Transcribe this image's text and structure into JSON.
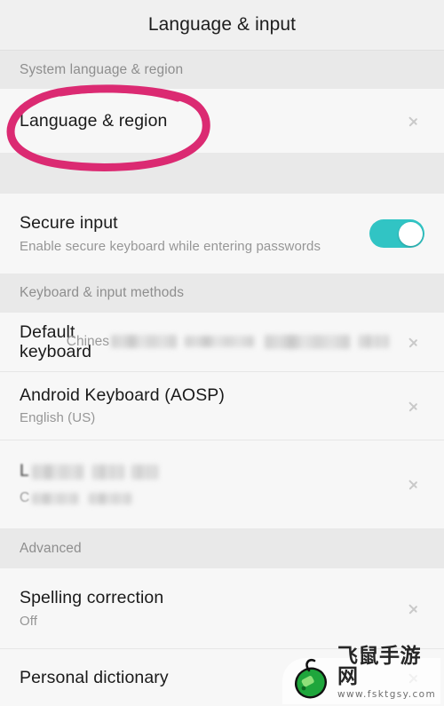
{
  "header": {
    "title": "Language & input"
  },
  "sections": {
    "system_language": {
      "label": "System language & region",
      "rows": [
        {
          "title": "Language & region",
          "chevron": "chevron-right-icon"
        }
      ]
    },
    "secure": {
      "rows": [
        {
          "title": "Secure input",
          "subtitle": "Enable secure keyboard while entering passwords",
          "toggle_state": "on"
        }
      ]
    },
    "keyboard_input_methods": {
      "label": "Keyboard & input methods",
      "rows": [
        {
          "title": "Default keyboard",
          "value_visible": "Chines",
          "value_redacted": true,
          "chevron": "chevron-right-icon"
        },
        {
          "title": "Android Keyboard (AOSP)",
          "subtitle": "English (US)",
          "chevron": "chevron-right-icon"
        },
        {
          "title_visible": "L",
          "title_redacted": true,
          "subtitle_visible": "C",
          "subtitle_redacted": true,
          "chevron": "chevron-right-icon"
        }
      ]
    },
    "advanced": {
      "label": "Advanced",
      "rows": [
        {
          "title": "Spelling correction",
          "subtitle": "Off",
          "chevron": "chevron-right-icon"
        },
        {
          "title": "Personal dictionary",
          "chevron": "chevron-right-icon"
        }
      ]
    }
  },
  "annotation": {
    "shape": "hand-drawn-oval",
    "color": "#DB2A72",
    "targets": "Language & region"
  },
  "watermark": {
    "brand_cn": "飞鼠手游网",
    "url": "www.fsktgsy.com",
    "logo": "green-mouse-logo"
  },
  "colors": {
    "toggle_on": "#31C4C4",
    "section_bg": "#E9E9E9",
    "row_bg": "#F7F7F7",
    "header_bg": "#F0F0F0",
    "annotation_pink": "#DB2A72"
  }
}
